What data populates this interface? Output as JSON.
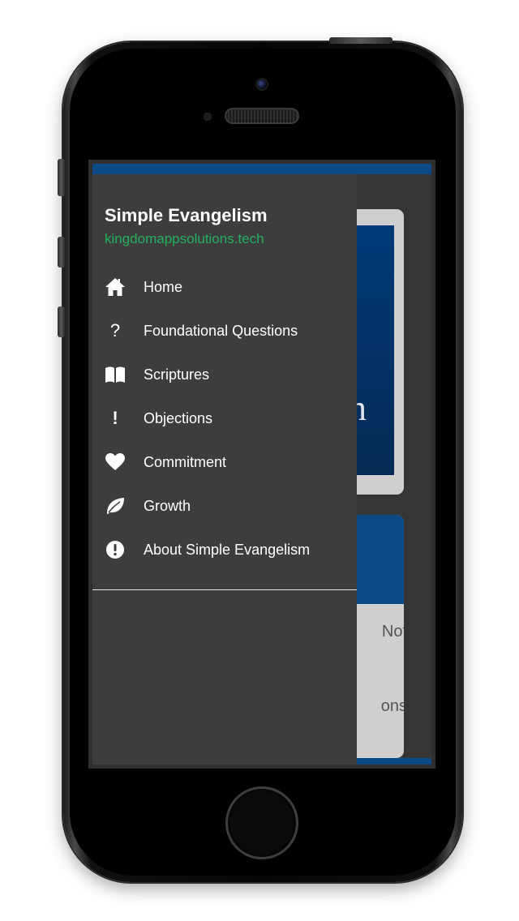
{
  "drawer": {
    "app_title": "Simple Evangelism",
    "website": "kingdomappsolutions.tech",
    "items": [
      {
        "label": "Home",
        "icon": "home-icon"
      },
      {
        "label": "Foundational Questions",
        "icon": "question-mark-icon"
      },
      {
        "label": "Scriptures",
        "icon": "book-open-icon"
      },
      {
        "label": "Objections",
        "icon": "exclamation-icon"
      },
      {
        "label": "Commitment",
        "icon": "heart-icon"
      },
      {
        "label": "Growth",
        "icon": "leaf-icon"
      },
      {
        "label": "About Simple Evangelism",
        "icon": "info-circle-icon"
      }
    ]
  },
  "background": {
    "card1_text": "n",
    "card2_line1": "Not",
    "card2_line2": "ons"
  },
  "colors": {
    "accent_blue": "#0d4a86",
    "website_green": "#24b05c",
    "drawer_bg": "#3d3d3d"
  }
}
